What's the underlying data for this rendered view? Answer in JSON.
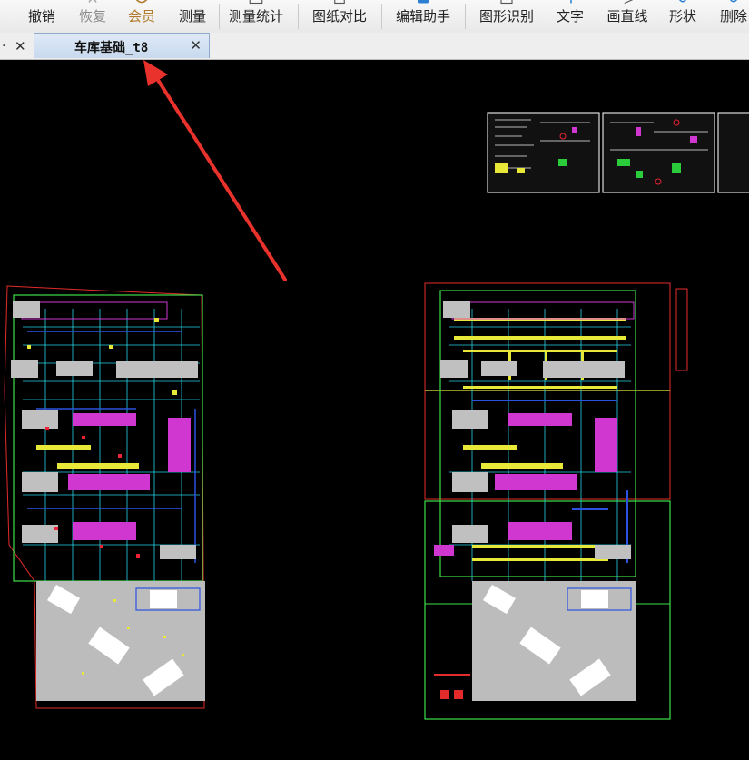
{
  "toolbar": {
    "undo": "撤销",
    "redo": "恢复",
    "member": "会员",
    "measure": "测量",
    "measure_stats": "测量统计",
    "drawing_compare": "图纸对比",
    "edit_helper": "编辑助手",
    "shape_recognition": "图形识别",
    "text": "文字",
    "draw_line": "画直线",
    "shape": "形状",
    "delete": "删除"
  },
  "tabs": {
    "previous_tab_label": "·",
    "active_tab_label": "车库基础_t8"
  },
  "colors": {
    "canvas_bg": "#000000",
    "annotation_arrow": "#e8322b",
    "tab_active_bg": "#d3e2f3"
  }
}
